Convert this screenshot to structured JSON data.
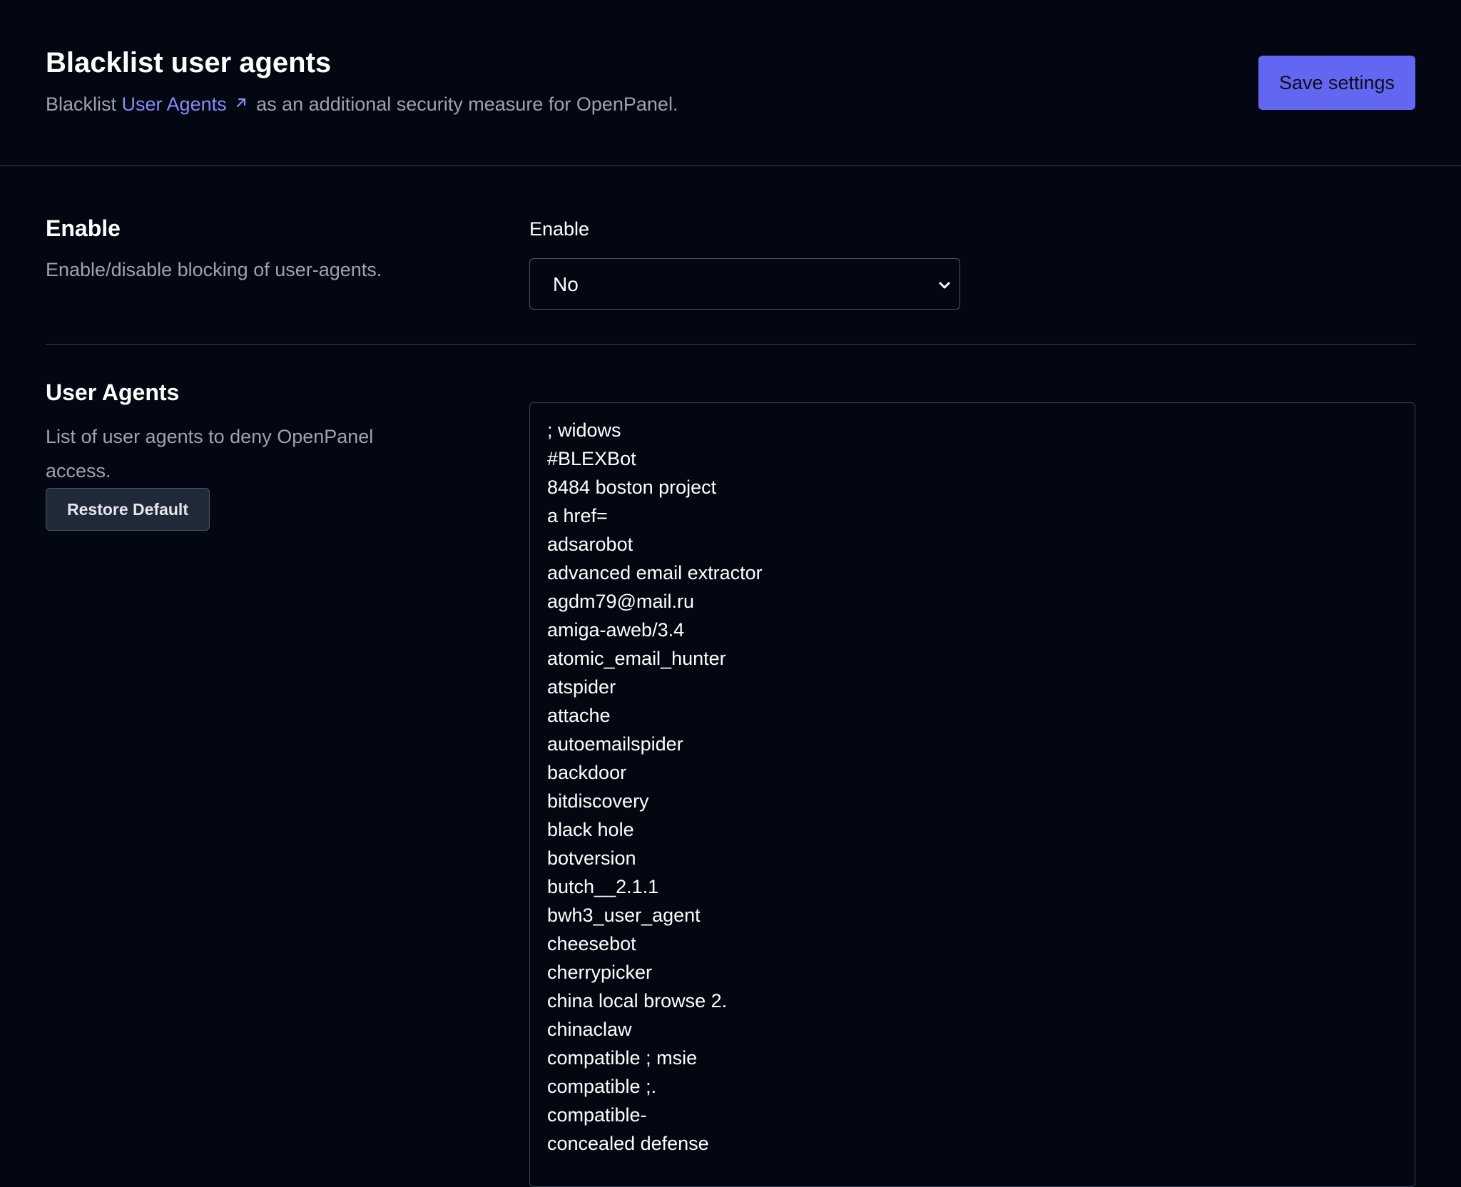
{
  "header": {
    "title": "Blacklist user agents",
    "subtitle_prefix": "Blacklist ",
    "subtitle_link": "User Agents",
    "subtitle_suffix": " as an additional security measure for OpenPanel.",
    "save_label": "Save settings"
  },
  "enable_section": {
    "title": "Enable",
    "description": "Enable/disable blocking of user-agents.",
    "field_label": "Enable",
    "selected_value": "No"
  },
  "user_agents_section": {
    "title": "User Agents",
    "description": "List of user agents to deny OpenPanel access.",
    "restore_label": "Restore Default",
    "lines": [
      "; widows",
      "#BLEXBot",
      "8484 boston project",
      "a href=",
      "adsarobot",
      "advanced email extractor",
      "agdm79@mail.ru",
      "amiga-aweb/3.4",
      "atomic_email_hunter",
      "atspider",
      "attache",
      "autoemailspider",
      "backdoor",
      "bitdiscovery",
      "black hole",
      "botversion",
      "butch__2.1.1",
      "bwh3_user_agent",
      "cheesebot",
      "cherrypicker",
      "china local browse 2.",
      "chinaclaw",
      "compatible ; msie",
      "compatible ;.",
      "compatible-",
      "concealed defense"
    ]
  },
  "colors": {
    "background": "#030712",
    "accent": "#6366f1",
    "link": "#818cf8",
    "muted_text": "#9ca3af",
    "border": "#374151"
  },
  "icons": {
    "external_link": "arrow-up-right-icon",
    "select_chevron": "chevron-down-icon"
  }
}
